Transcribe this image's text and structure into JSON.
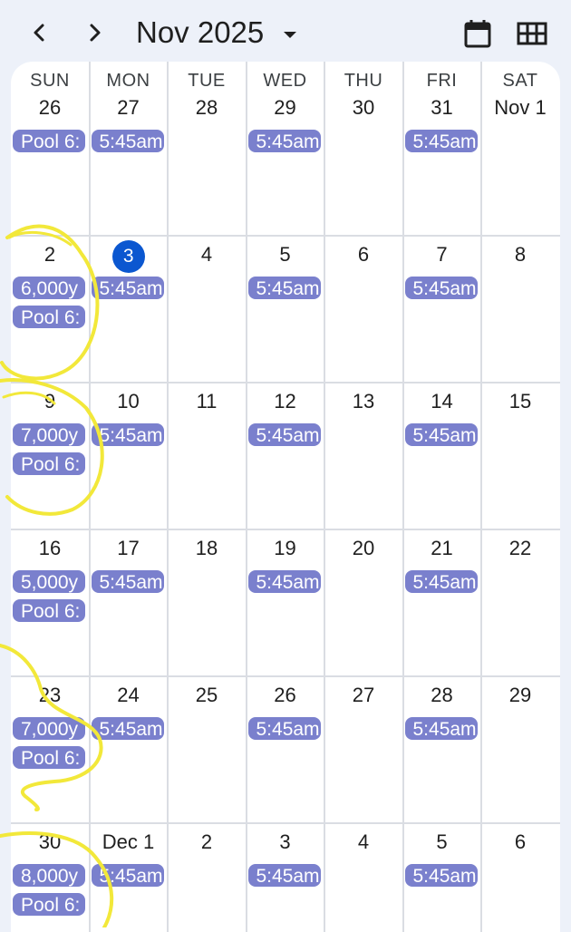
{
  "header": {
    "month_title": "Nov 2025"
  },
  "icons": {
    "prev": "chevron-left-icon",
    "next": "chevron-right-icon",
    "dropdown": "triangle-down-icon",
    "day_view": "calendar-icon",
    "month_view": "grid-icon"
  },
  "colors": {
    "background": "#edf1f9",
    "chip": "#7a80cd",
    "today": "#0b57d0",
    "annotation": "#f2e83a"
  },
  "weekdays": [
    "SUN",
    "MON",
    "TUE",
    "WED",
    "THU",
    "FRI",
    "SAT"
  ],
  "weeks": [
    {
      "days": [
        {
          "label": "26",
          "events": [
            "Pool 6:"
          ]
        },
        {
          "label": "27",
          "events": [
            "5:45am"
          ]
        },
        {
          "label": "28",
          "events": []
        },
        {
          "label": "29",
          "events": [
            "5:45am"
          ]
        },
        {
          "label": "30",
          "events": []
        },
        {
          "label": "31",
          "events": [
            "5:45am"
          ]
        },
        {
          "label": "Nov 1",
          "events": []
        }
      ]
    },
    {
      "days": [
        {
          "label": "2",
          "events": [
            "6,000y",
            "Pool 6:"
          ]
        },
        {
          "label": "3",
          "today": true,
          "events": [
            "5:45am"
          ]
        },
        {
          "label": "4",
          "events": []
        },
        {
          "label": "5",
          "events": [
            "5:45am"
          ]
        },
        {
          "label": "6",
          "events": []
        },
        {
          "label": "7",
          "events": [
            "5:45am"
          ]
        },
        {
          "label": "8",
          "events": []
        }
      ]
    },
    {
      "days": [
        {
          "label": "9",
          "events": [
            "7,000y",
            "Pool 6:"
          ]
        },
        {
          "label": "10",
          "events": [
            "5:45am"
          ]
        },
        {
          "label": "11",
          "events": []
        },
        {
          "label": "12",
          "events": [
            "5:45am"
          ]
        },
        {
          "label": "13",
          "events": []
        },
        {
          "label": "14",
          "events": [
            "5:45am"
          ]
        },
        {
          "label": "15",
          "events": []
        }
      ]
    },
    {
      "days": [
        {
          "label": "16",
          "events": [
            "5,000y",
            "Pool 6:"
          ]
        },
        {
          "label": "17",
          "events": [
            "5:45am"
          ]
        },
        {
          "label": "18",
          "events": []
        },
        {
          "label": "19",
          "events": [
            "5:45am"
          ]
        },
        {
          "label": "20",
          "events": []
        },
        {
          "label": "21",
          "events": [
            "5:45am"
          ]
        },
        {
          "label": "22",
          "events": []
        }
      ]
    },
    {
      "days": [
        {
          "label": "23",
          "events": [
            "7,000y",
            "Pool 6:"
          ]
        },
        {
          "label": "24",
          "events": [
            "5:45am"
          ]
        },
        {
          "label": "25",
          "events": []
        },
        {
          "label": "26",
          "events": [
            "5:45am"
          ]
        },
        {
          "label": "27",
          "events": []
        },
        {
          "label": "28",
          "events": [
            "5:45am"
          ]
        },
        {
          "label": "29",
          "events": []
        }
      ]
    },
    {
      "days": [
        {
          "label": "30",
          "events": [
            "8,000y",
            "Pool 6:"
          ]
        },
        {
          "label": "Dec 1",
          "events": [
            "5:45am"
          ]
        },
        {
          "label": "2",
          "events": []
        },
        {
          "label": "3",
          "events": [
            "5:45am"
          ]
        },
        {
          "label": "4",
          "events": []
        },
        {
          "label": "5",
          "events": [
            "5:45am"
          ]
        },
        {
          "label": "6",
          "events": []
        }
      ]
    }
  ]
}
